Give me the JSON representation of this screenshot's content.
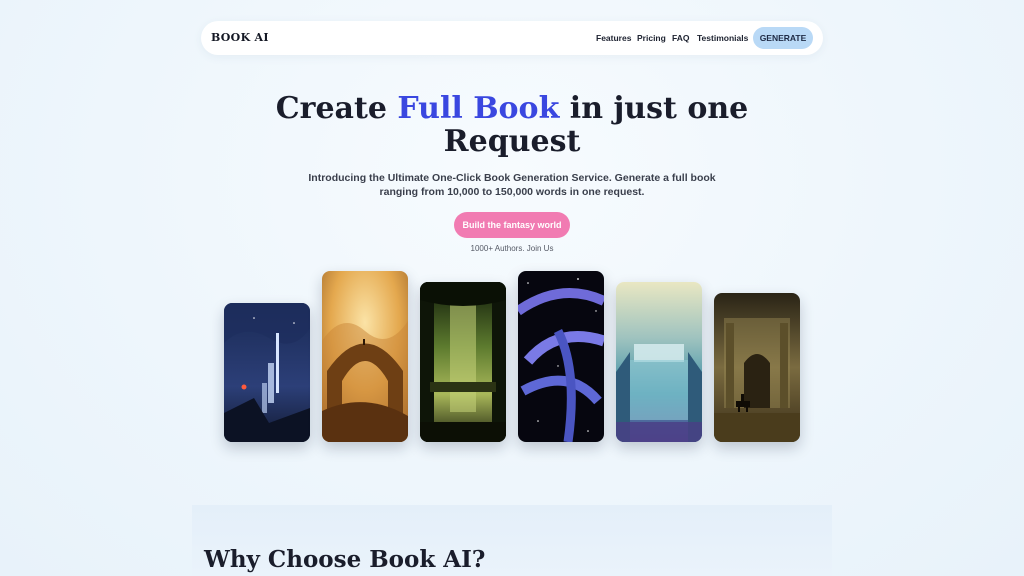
{
  "header": {
    "logo": "BOOK AI",
    "nav": [
      "Features",
      "Pricing",
      "FAQ",
      "Testimonials"
    ],
    "generate_label": "GENERATE"
  },
  "hero": {
    "title_pre": "Create ",
    "title_highlight": "Full Book",
    "title_post": " in just one Request",
    "subtitle": "Introducing the Ultimate One-Click Book Generation Service. Generate a full book ranging from 10,000 to 150,000 words in one request.",
    "cta_label": "Build the fantasy world",
    "authors_note": "1000+ Authors. Join Us"
  },
  "gallery": {
    "images": [
      "night-tower-artwork",
      "desert-arch-artwork",
      "jungle-ruins-artwork",
      "space-spiral-artwork",
      "waterfall-city-artwork",
      "ancient-temple-rider-artwork"
    ]
  },
  "section": {
    "why_title": "Why Choose Book AI?"
  },
  "colors": {
    "accent": "#3a47e0",
    "cta": "#f17bb2",
    "generate_button": "#b9d9f6"
  }
}
